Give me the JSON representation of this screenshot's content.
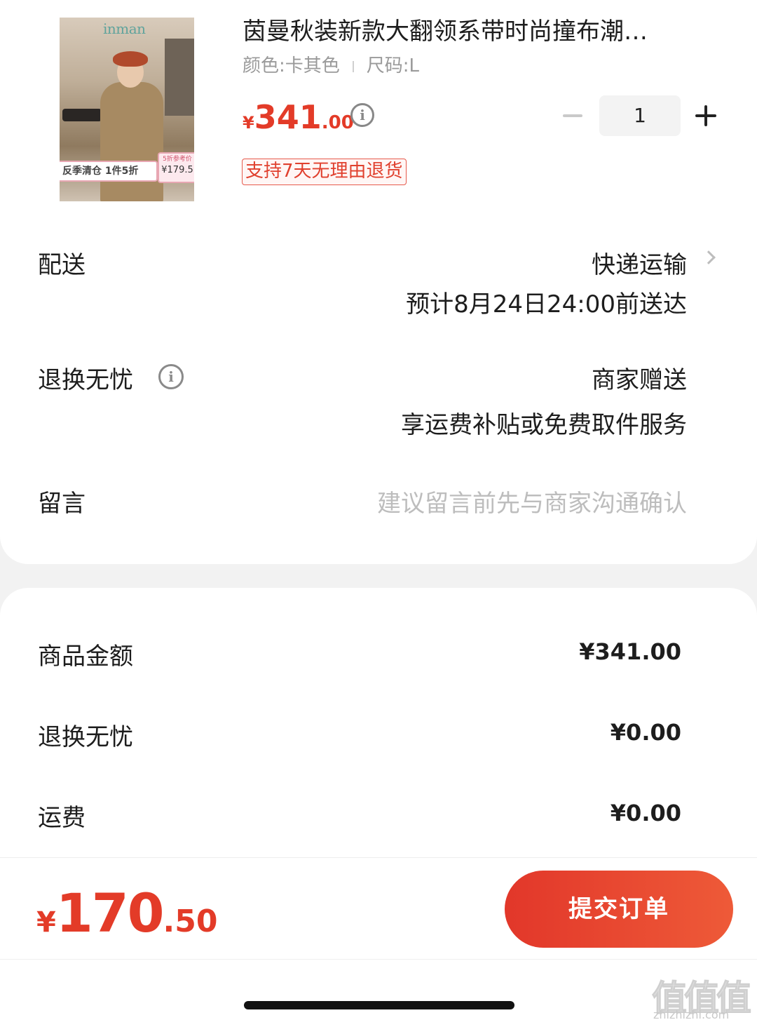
{
  "product": {
    "image_brand": "inman",
    "promo_left": "反季清仓 1件5折",
    "promo_right_note": "5折参考价",
    "promo_right_price": "¥179.5",
    "title": "茵曼秋装新款大翻领系带时尚撞布潮…",
    "color": "颜色:卡其色",
    "size": "尺码:L",
    "price_currency": "¥",
    "price_int": "341",
    "price_dec": ".00",
    "quantity": "1",
    "return_tag": "支持7天无理由退货"
  },
  "delivery": {
    "label": "配送",
    "method": "快递运输",
    "eta": "预计8月24日24:00前送达"
  },
  "worry_free": {
    "label": "退换无忧",
    "provider": "商家赠送",
    "desc": "享运费补贴或免费取件服务"
  },
  "message": {
    "label": "留言",
    "placeholder": "建议留言前先与商家沟通确认"
  },
  "summary": [
    {
      "label": "商品金额",
      "value": "¥341.00"
    },
    {
      "label": "退换无忧",
      "value": "¥0.00"
    },
    {
      "label": "运费",
      "value": "¥0.00"
    }
  ],
  "footer": {
    "total_currency": "¥",
    "total_int": "170",
    "total_dec": ".50",
    "submit_label": "提交订单"
  },
  "watermark": {
    "big": "值值值",
    "small": "zhizhizhi.com"
  },
  "colors": {
    "accent": "#e33b28",
    "button_gradient_start": "#e2372a",
    "button_gradient_end": "#ee5a38"
  }
}
